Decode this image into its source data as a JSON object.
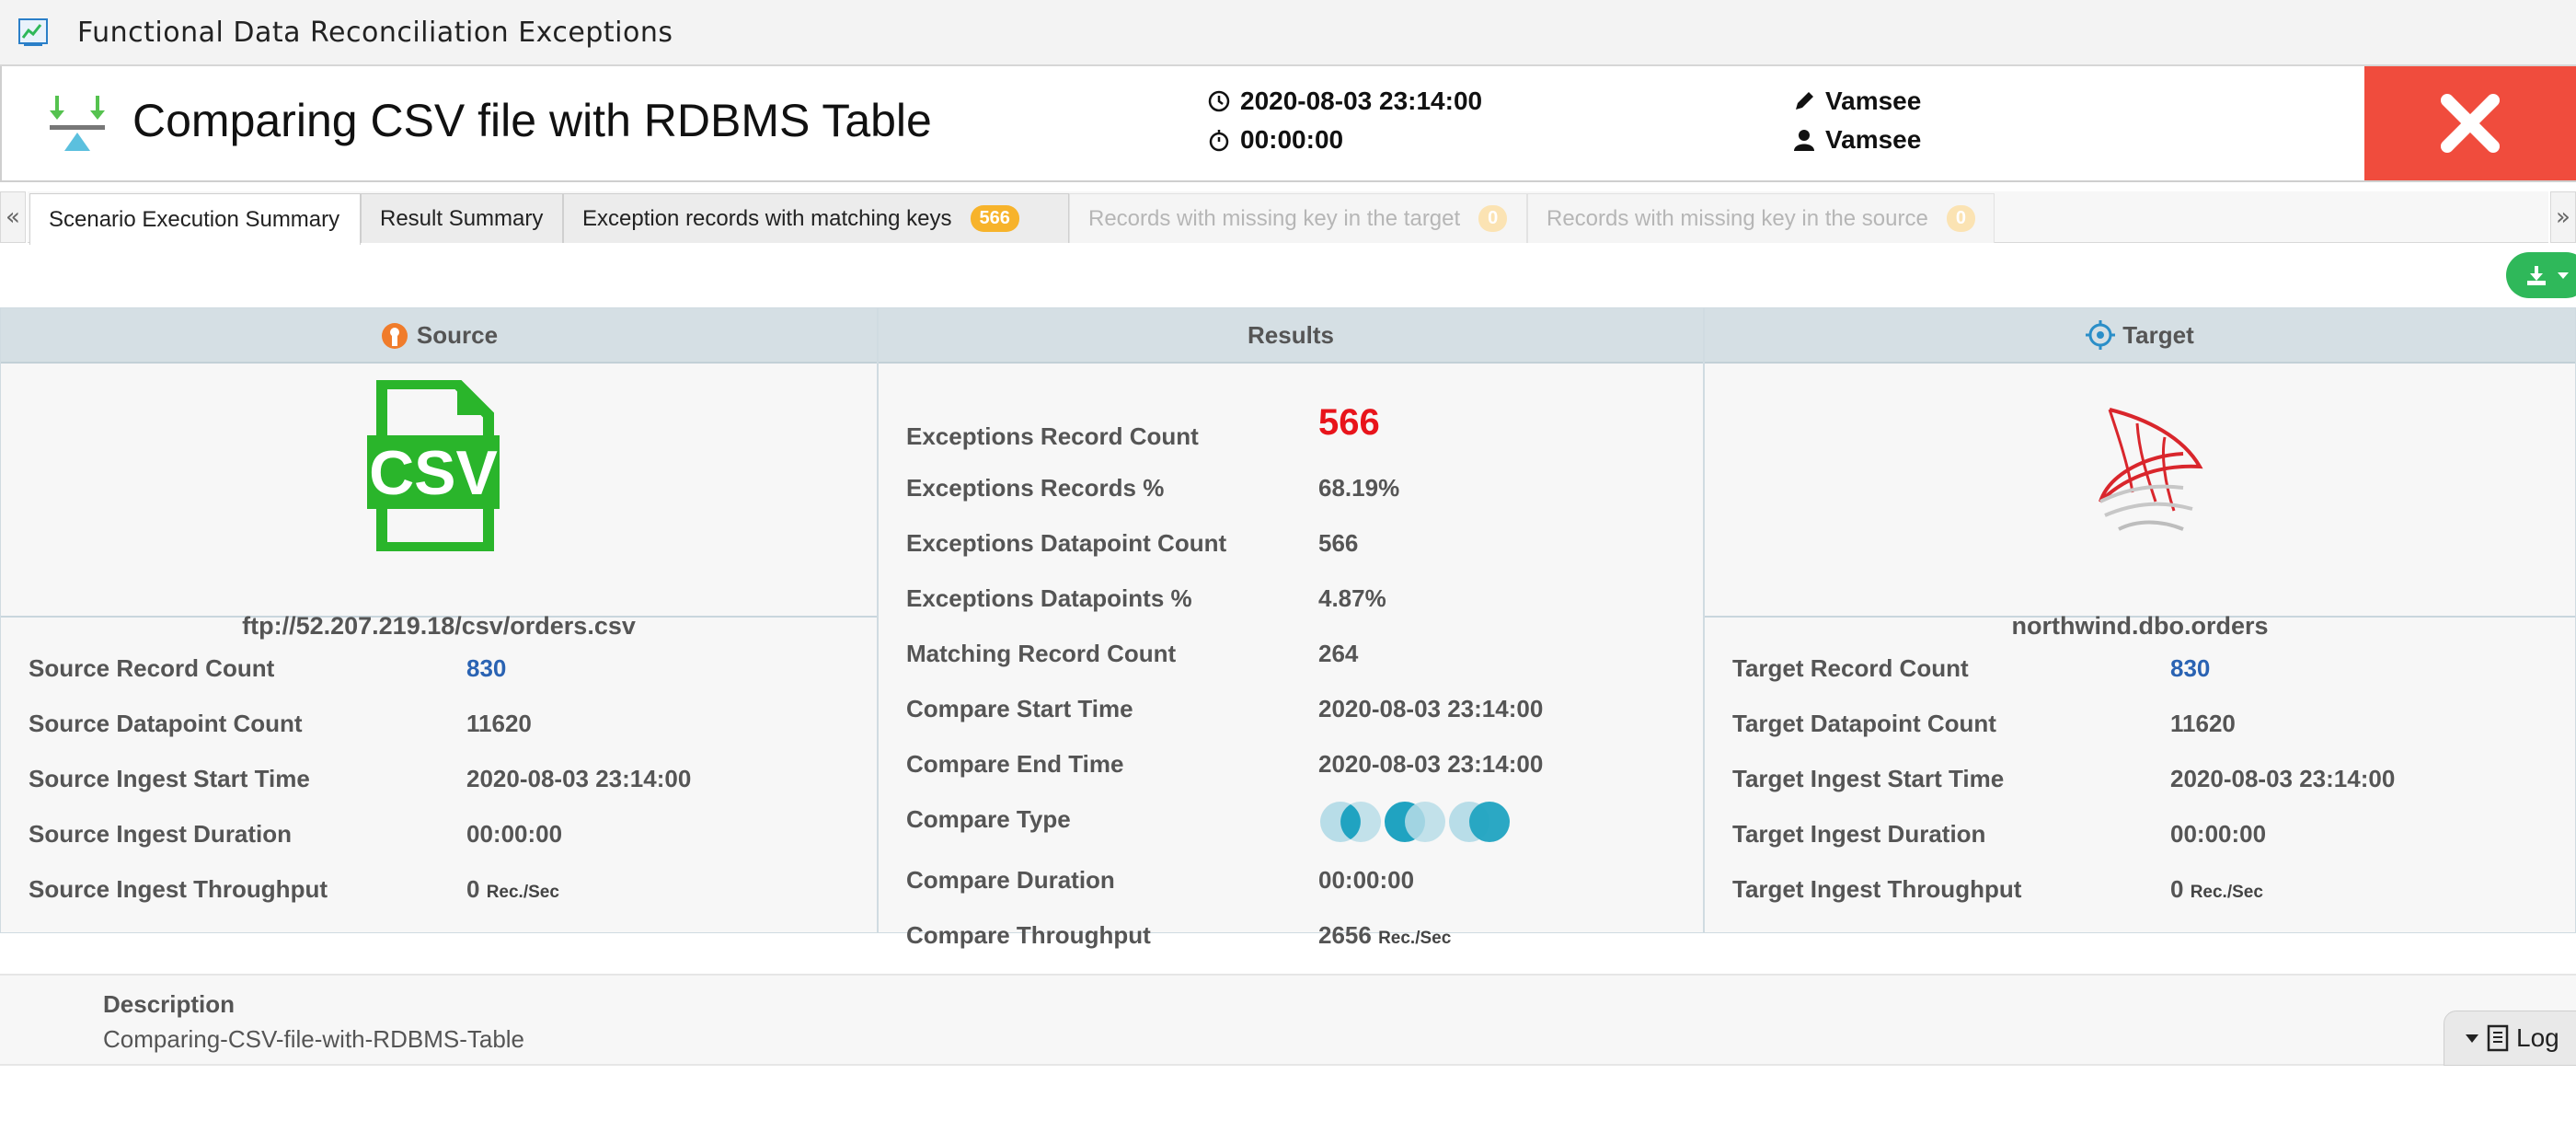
{
  "window": {
    "title": "Functional Data Reconciliation Exceptions"
  },
  "header": {
    "title": "Comparing CSV file with RDBMS Table",
    "datetime": "2020-08-03 23:14:00",
    "duration": "00:00:00",
    "edited_by": "Vamsee",
    "owner": "Vamsee"
  },
  "nav": {
    "prev": "«",
    "next": "»"
  },
  "tabs": [
    {
      "label": "Scenario Execution Summary",
      "state": "active"
    },
    {
      "label": "Result Summary",
      "state": "normal"
    },
    {
      "label": "Exception records with matching keys",
      "badge": "566",
      "state": "normal"
    },
    {
      "label": "Records with missing key in the target",
      "badge": "0",
      "state": "disabled"
    },
    {
      "label": "Records with missing key in the source",
      "badge": "0",
      "state": "disabled"
    }
  ],
  "source": {
    "heading": "Source",
    "icon_text": "CSV",
    "location": "ftp://52.207.219.18/csv/orders.csv",
    "rows": [
      {
        "label": "Source Record Count",
        "value": "830"
      },
      {
        "label": "Source Datapoint Count",
        "value": "11620"
      },
      {
        "label": "Source Ingest Start Time",
        "value": "2020-08-03 23:14:00"
      },
      {
        "label": "Source Ingest Duration",
        "value": "00:00:00"
      },
      {
        "label": "Source Ingest Throughput",
        "value": "0",
        "unit": "Rec./Sec"
      }
    ]
  },
  "results": {
    "heading": "Results",
    "rows": [
      {
        "label": "Exceptions Record Count",
        "value": "566"
      },
      {
        "label": "Exceptions Records %",
        "value": "68.19%"
      },
      {
        "label": "Exceptions Datapoint Count",
        "value": "566"
      },
      {
        "label": "Exceptions Datapoints %",
        "value": "4.87%"
      },
      {
        "label": "Matching Record Count",
        "value": "264"
      },
      {
        "label": "Compare Start Time",
        "value": "2020-08-03 23:14:00"
      },
      {
        "label": "Compare End Time",
        "value": "2020-08-03 23:14:00"
      },
      {
        "label": "Compare Type",
        "value": ""
      },
      {
        "label": "Compare Duration",
        "value": "00:00:00"
      },
      {
        "label": "Compare Throughput",
        "value": "2656",
        "unit": "Rec./Sec"
      }
    ]
  },
  "target": {
    "heading": "Target",
    "location": "northwind.dbo.orders",
    "rows": [
      {
        "label": "Target Record Count",
        "value": "830"
      },
      {
        "label": "Target Datapoint Count",
        "value": "11620"
      },
      {
        "label": "Target Ingest Start Time",
        "value": "2020-08-03 23:14:00"
      },
      {
        "label": "Target Ingest Duration",
        "value": "00:00:00"
      },
      {
        "label": "Target Ingest Throughput",
        "value": "0",
        "unit": "Rec./Sec"
      }
    ]
  },
  "description": {
    "label": "Description",
    "text": "Comparing-CSV-file-with-RDBMS-Table"
  },
  "log": {
    "label": "Log"
  },
  "colors": {
    "close": "#f04c3d",
    "export": "#2fb85a",
    "badge": "#f7b32b",
    "exceptions": "#e8141b",
    "link": "#2a63b3",
    "csv": "#2ab52b",
    "compare_icon": "#20a3c1"
  }
}
